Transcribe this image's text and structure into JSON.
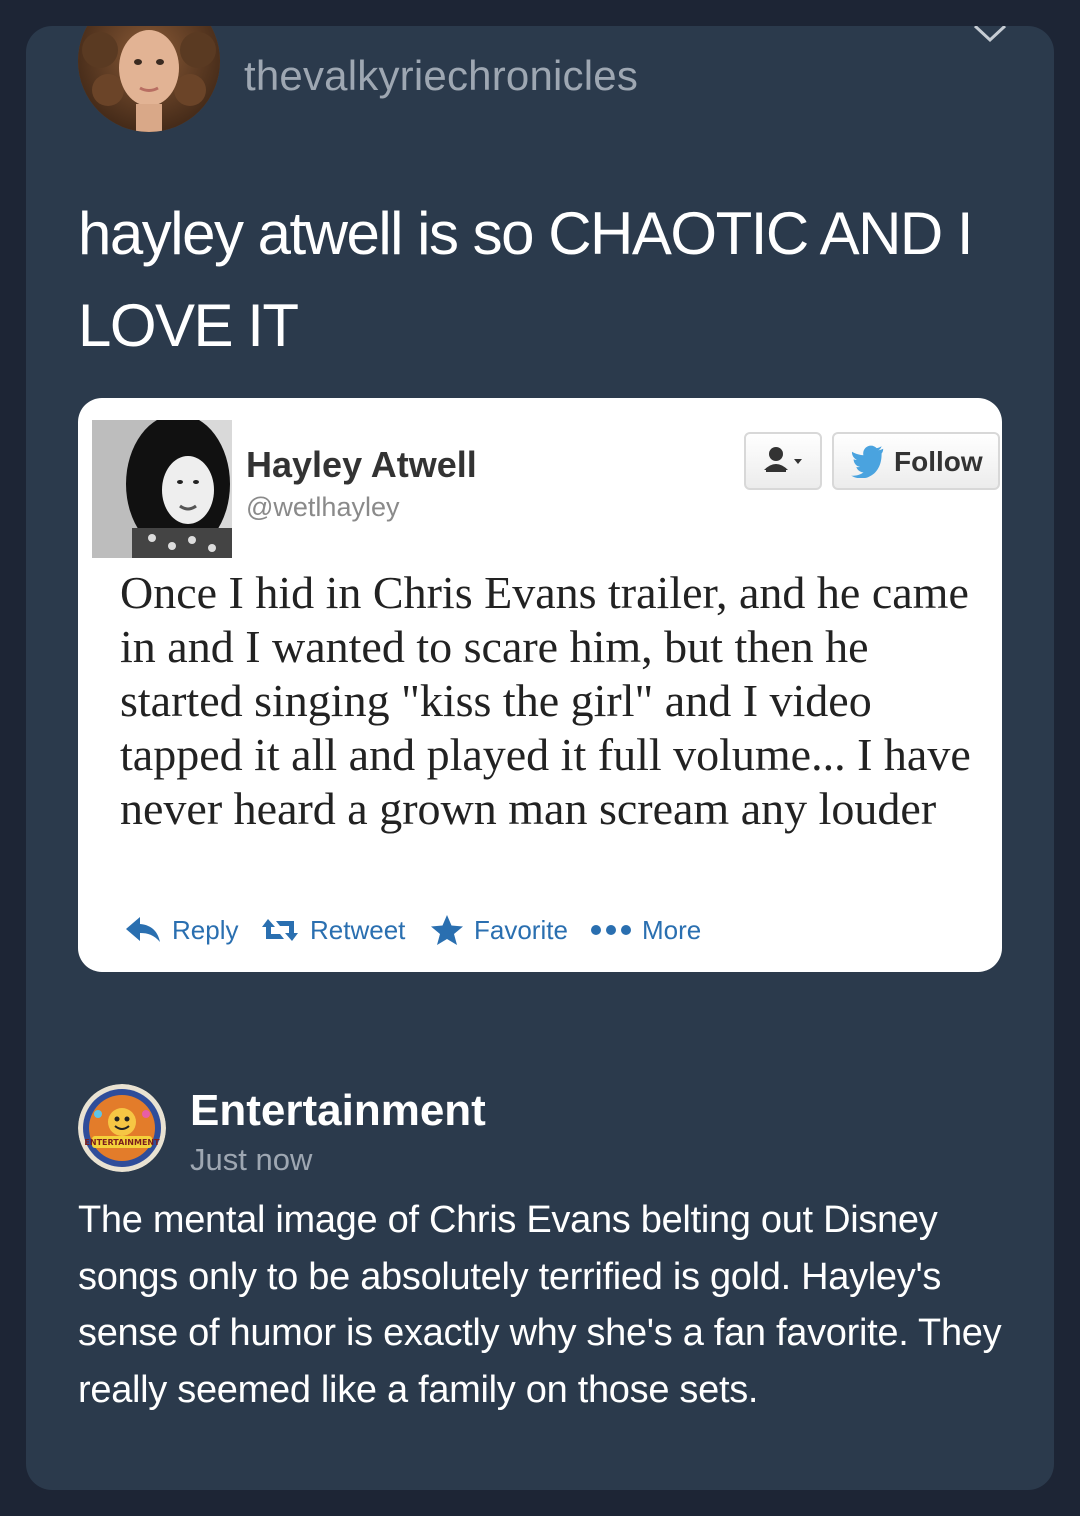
{
  "post": {
    "username": "thevalkyriechronicles",
    "text": "hayley atwell is so CHAOTIC AND I LOVE IT",
    "avatar_icon": "profile-photo"
  },
  "tweet": {
    "name": "Hayley Atwell",
    "handle": "@wetlhayley",
    "follow_label": "Follow",
    "text": "Once I hid in Chris Evans trailer, and he came in and I wanted to scare him, but then he started singing \"kiss the girl\" and I video tapped it all and played it full volume... I have never heard a grown man scream any louder",
    "actions": {
      "reply": "Reply",
      "retweet": "Retweet",
      "favorite": "Favorite",
      "more": "More"
    },
    "colors": {
      "link": "#2a6fb0",
      "twitter_blue": "#4aa3df"
    }
  },
  "comment": {
    "name": "Entertainment",
    "time": "Just now",
    "text": "The mental image of Chris Evans belting out Disney songs only to be absolutely terrified is gold. Hayley's sense of humor is exactly why she's a fan favorite. They really seemed like a family on those sets.",
    "badge_text": "ENTERTAINMENT"
  },
  "colors": {
    "page_bg": "#1d2535",
    "card_bg": "#2b3a4c",
    "muted_text": "#9ea7b2"
  }
}
